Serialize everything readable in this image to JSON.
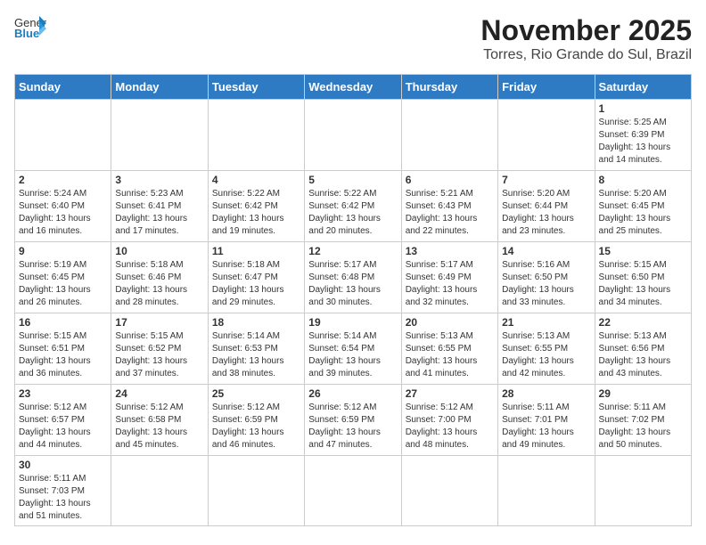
{
  "header": {
    "logo_general": "General",
    "logo_blue": "Blue",
    "month": "November 2025",
    "location": "Torres, Rio Grande do Sul, Brazil"
  },
  "days_of_week": [
    "Sunday",
    "Monday",
    "Tuesday",
    "Wednesday",
    "Thursday",
    "Friday",
    "Saturday"
  ],
  "weeks": [
    [
      {
        "day": "",
        "info": ""
      },
      {
        "day": "",
        "info": ""
      },
      {
        "day": "",
        "info": ""
      },
      {
        "day": "",
        "info": ""
      },
      {
        "day": "",
        "info": ""
      },
      {
        "day": "",
        "info": ""
      },
      {
        "day": "1",
        "info": "Sunrise: 5:25 AM\nSunset: 6:39 PM\nDaylight: 13 hours\nand 14 minutes."
      }
    ],
    [
      {
        "day": "2",
        "info": "Sunrise: 5:24 AM\nSunset: 6:40 PM\nDaylight: 13 hours\nand 16 minutes."
      },
      {
        "day": "3",
        "info": "Sunrise: 5:23 AM\nSunset: 6:41 PM\nDaylight: 13 hours\nand 17 minutes."
      },
      {
        "day": "4",
        "info": "Sunrise: 5:22 AM\nSunset: 6:42 PM\nDaylight: 13 hours\nand 19 minutes."
      },
      {
        "day": "5",
        "info": "Sunrise: 5:22 AM\nSunset: 6:42 PM\nDaylight: 13 hours\nand 20 minutes."
      },
      {
        "day": "6",
        "info": "Sunrise: 5:21 AM\nSunset: 6:43 PM\nDaylight: 13 hours\nand 22 minutes."
      },
      {
        "day": "7",
        "info": "Sunrise: 5:20 AM\nSunset: 6:44 PM\nDaylight: 13 hours\nand 23 minutes."
      },
      {
        "day": "8",
        "info": "Sunrise: 5:20 AM\nSunset: 6:45 PM\nDaylight: 13 hours\nand 25 minutes."
      }
    ],
    [
      {
        "day": "9",
        "info": "Sunrise: 5:19 AM\nSunset: 6:45 PM\nDaylight: 13 hours\nand 26 minutes."
      },
      {
        "day": "10",
        "info": "Sunrise: 5:18 AM\nSunset: 6:46 PM\nDaylight: 13 hours\nand 28 minutes."
      },
      {
        "day": "11",
        "info": "Sunrise: 5:18 AM\nSunset: 6:47 PM\nDaylight: 13 hours\nand 29 minutes."
      },
      {
        "day": "12",
        "info": "Sunrise: 5:17 AM\nSunset: 6:48 PM\nDaylight: 13 hours\nand 30 minutes."
      },
      {
        "day": "13",
        "info": "Sunrise: 5:17 AM\nSunset: 6:49 PM\nDaylight: 13 hours\nand 32 minutes."
      },
      {
        "day": "14",
        "info": "Sunrise: 5:16 AM\nSunset: 6:50 PM\nDaylight: 13 hours\nand 33 minutes."
      },
      {
        "day": "15",
        "info": "Sunrise: 5:15 AM\nSunset: 6:50 PM\nDaylight: 13 hours\nand 34 minutes."
      }
    ],
    [
      {
        "day": "16",
        "info": "Sunrise: 5:15 AM\nSunset: 6:51 PM\nDaylight: 13 hours\nand 36 minutes."
      },
      {
        "day": "17",
        "info": "Sunrise: 5:15 AM\nSunset: 6:52 PM\nDaylight: 13 hours\nand 37 minutes."
      },
      {
        "day": "18",
        "info": "Sunrise: 5:14 AM\nSunset: 6:53 PM\nDaylight: 13 hours\nand 38 minutes."
      },
      {
        "day": "19",
        "info": "Sunrise: 5:14 AM\nSunset: 6:54 PM\nDaylight: 13 hours\nand 39 minutes."
      },
      {
        "day": "20",
        "info": "Sunrise: 5:13 AM\nSunset: 6:55 PM\nDaylight: 13 hours\nand 41 minutes."
      },
      {
        "day": "21",
        "info": "Sunrise: 5:13 AM\nSunset: 6:55 PM\nDaylight: 13 hours\nand 42 minutes."
      },
      {
        "day": "22",
        "info": "Sunrise: 5:13 AM\nSunset: 6:56 PM\nDaylight: 13 hours\nand 43 minutes."
      }
    ],
    [
      {
        "day": "23",
        "info": "Sunrise: 5:12 AM\nSunset: 6:57 PM\nDaylight: 13 hours\nand 44 minutes."
      },
      {
        "day": "24",
        "info": "Sunrise: 5:12 AM\nSunset: 6:58 PM\nDaylight: 13 hours\nand 45 minutes."
      },
      {
        "day": "25",
        "info": "Sunrise: 5:12 AM\nSunset: 6:59 PM\nDaylight: 13 hours\nand 46 minutes."
      },
      {
        "day": "26",
        "info": "Sunrise: 5:12 AM\nSunset: 6:59 PM\nDaylight: 13 hours\nand 47 minutes."
      },
      {
        "day": "27",
        "info": "Sunrise: 5:12 AM\nSunset: 7:00 PM\nDaylight: 13 hours\nand 48 minutes."
      },
      {
        "day": "28",
        "info": "Sunrise: 5:11 AM\nSunset: 7:01 PM\nDaylight: 13 hours\nand 49 minutes."
      },
      {
        "day": "29",
        "info": "Sunrise: 5:11 AM\nSunset: 7:02 PM\nDaylight: 13 hours\nand 50 minutes."
      }
    ],
    [
      {
        "day": "30",
        "info": "Sunrise: 5:11 AM\nSunset: 7:03 PM\nDaylight: 13 hours\nand 51 minutes."
      },
      {
        "day": "",
        "info": ""
      },
      {
        "day": "",
        "info": ""
      },
      {
        "day": "",
        "info": ""
      },
      {
        "day": "",
        "info": ""
      },
      {
        "day": "",
        "info": ""
      },
      {
        "day": "",
        "info": ""
      }
    ]
  ]
}
